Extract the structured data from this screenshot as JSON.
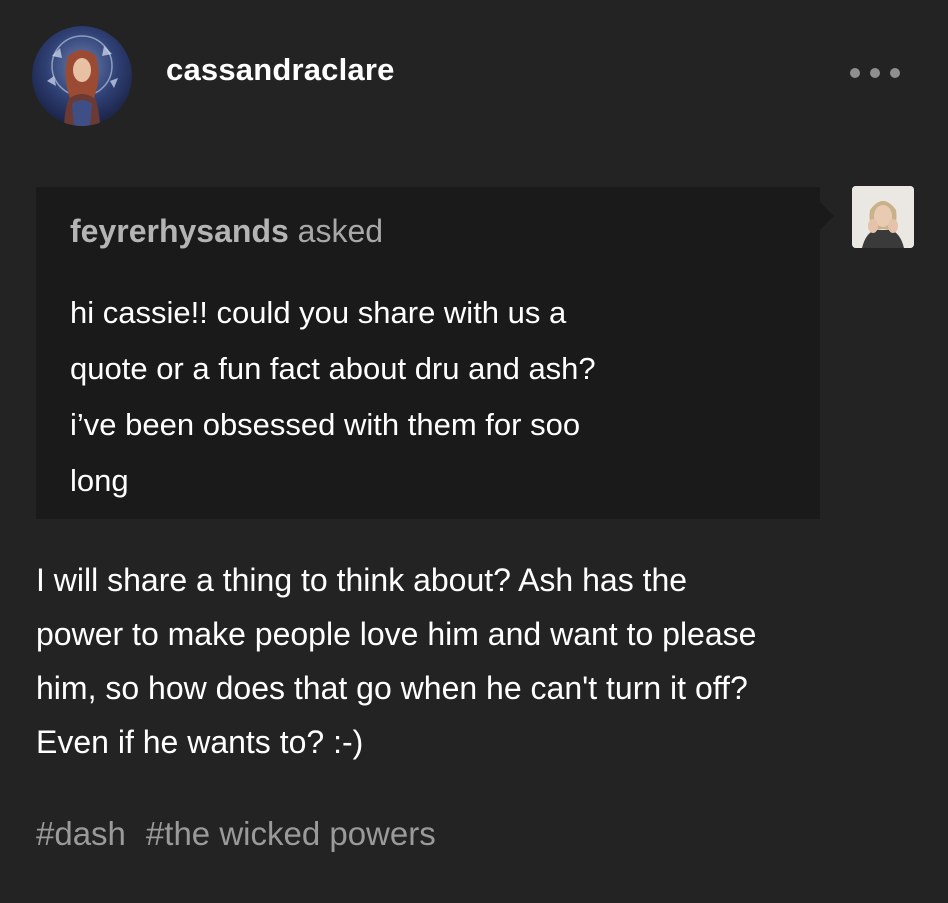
{
  "post": {
    "author": "cassandraclare",
    "ask": {
      "asker": "feyrerhysands",
      "verb": "asked",
      "question_lines": [
        "hi cassie!! could you share with us a",
        "quote or a fun fact about dru and ash?",
        "i’ve been obsessed with them for soo",
        "long"
      ]
    },
    "answer_lines": [
      "I will share a thing to think about? Ash has the",
      "power to make people love him and want to please",
      "him, so how does that go when he can't turn it off?",
      "Even if he wants to? :-)"
    ],
    "tags": [
      "#dash",
      "#the wicked powers"
    ]
  },
  "icons": {
    "more": "more-horizontal-icon",
    "author_avatar": "avatar-illustration",
    "asker_avatar": "avatar-photo"
  },
  "colors": {
    "background": "#232323",
    "ask_background": "#1a1a1a",
    "text": "#ffffff",
    "muted_text": "#a8a8a8",
    "tag_text": "#9a9a9a"
  }
}
